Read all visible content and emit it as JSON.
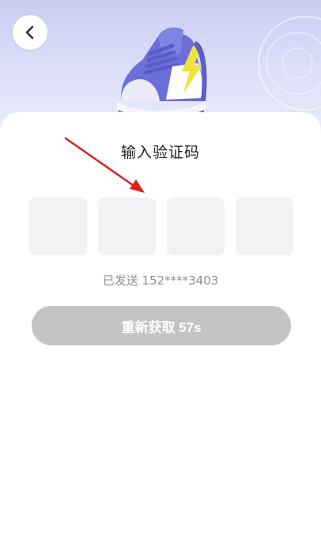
{
  "header": {
    "back_icon": "chevron-left-icon"
  },
  "hero": {
    "image": "sneaker-illustration",
    "colors": {
      "purple": "#6b6fd9",
      "yellow": "#f2e33b"
    }
  },
  "main": {
    "title": "输入验证码",
    "code_boxes": [
      "",
      "",
      "",
      ""
    ],
    "sent_text": "已发送 152****3403",
    "resend_label": "重新获取 57s"
  },
  "annotation": {
    "type": "red-arrow",
    "color": "#d82020"
  }
}
